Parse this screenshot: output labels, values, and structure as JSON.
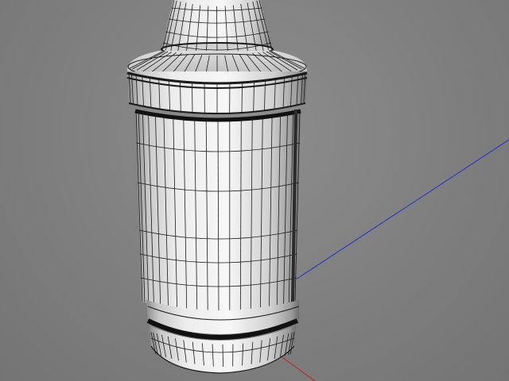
{
  "viewport": {
    "view": "perspective",
    "display_mode": "shaded-wireframe",
    "background_color": "#808080"
  },
  "scene": {
    "object": {
      "type": "bottle",
      "parts": [
        "neck",
        "shoulder-cap",
        "upper-ring",
        "body",
        "bottom-ring",
        "base"
      ],
      "material_color": "#e6e6e6",
      "wire_color": "#1a1a1a"
    },
    "axes": [
      {
        "name": "z-axis",
        "color": "#1f35c8"
      },
      {
        "name": "x-axis",
        "color": "#c81f1f"
      }
    ]
  }
}
